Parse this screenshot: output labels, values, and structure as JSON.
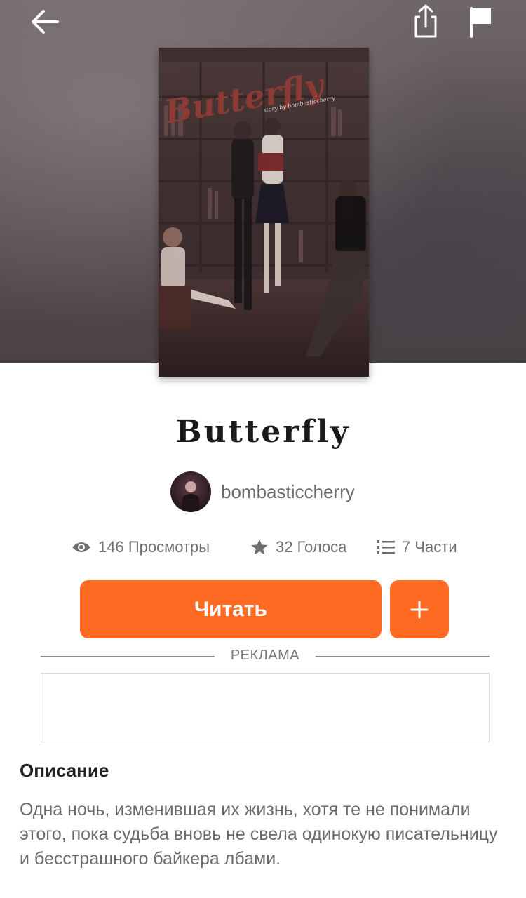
{
  "book": {
    "title": "Butterfly",
    "cover": {
      "title_text": "Butterfly",
      "subtitle_text": "story by bombasticcherry"
    },
    "author": "bombasticcherry"
  },
  "stats": {
    "views": "146 Просмотры",
    "votes": "32 Голоса",
    "parts": "7 Части"
  },
  "actions": {
    "read_label": "Читать",
    "add_label": "+"
  },
  "ad": {
    "label": "РЕКЛАМА"
  },
  "description": {
    "heading": "Описание",
    "text": "Одна ночь, изменившая их жизнь, хотя те не понимали этого, пока судьба вновь не свела одинокую писательницу и бесстрашного байкера лбами."
  },
  "colors": {
    "accent": "#ff6b22",
    "muted_text": "#6f6f6f"
  },
  "icons": {
    "back": "arrow-left-icon",
    "share": "share-icon",
    "report": "flag-icon",
    "views": "eye-icon",
    "votes": "star-icon",
    "parts": "list-icon"
  }
}
